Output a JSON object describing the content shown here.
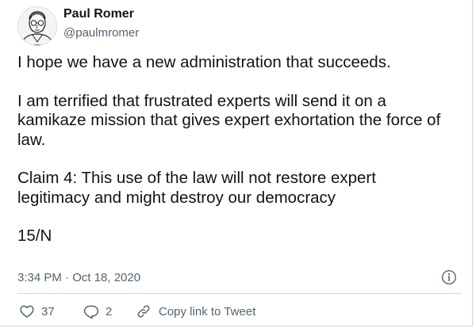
{
  "author": {
    "name": "Paul Romer",
    "handle": "@paulmromer"
  },
  "tweet": {
    "paragraphs": [
      [
        "I hope we have a new administration that succeeds."
      ],
      [
        "I am terrified that frustrated experts will send it on a",
        "kamikaze mission that gives expert exhortation the force of",
        "law."
      ],
      [
        "Claim 4: This use of the law will not restore expert",
        "legitimacy and might destroy our democracy"
      ],
      [
        "15/N"
      ]
    ],
    "timestamp": "3:34 PM · Oct 18, 2020"
  },
  "actions": {
    "like_count": "37",
    "reply_count": "2",
    "copy_link_label": "Copy link to Tweet"
  },
  "icons": {
    "avatar": "avatar-portrait-sketch",
    "info": "info-icon",
    "like": "heart-icon",
    "reply": "reply-bubble-icon",
    "copy": "link-icon"
  },
  "colors": {
    "text": "#0f1419",
    "secondary": "#536471",
    "divider": "#cfd9de"
  }
}
